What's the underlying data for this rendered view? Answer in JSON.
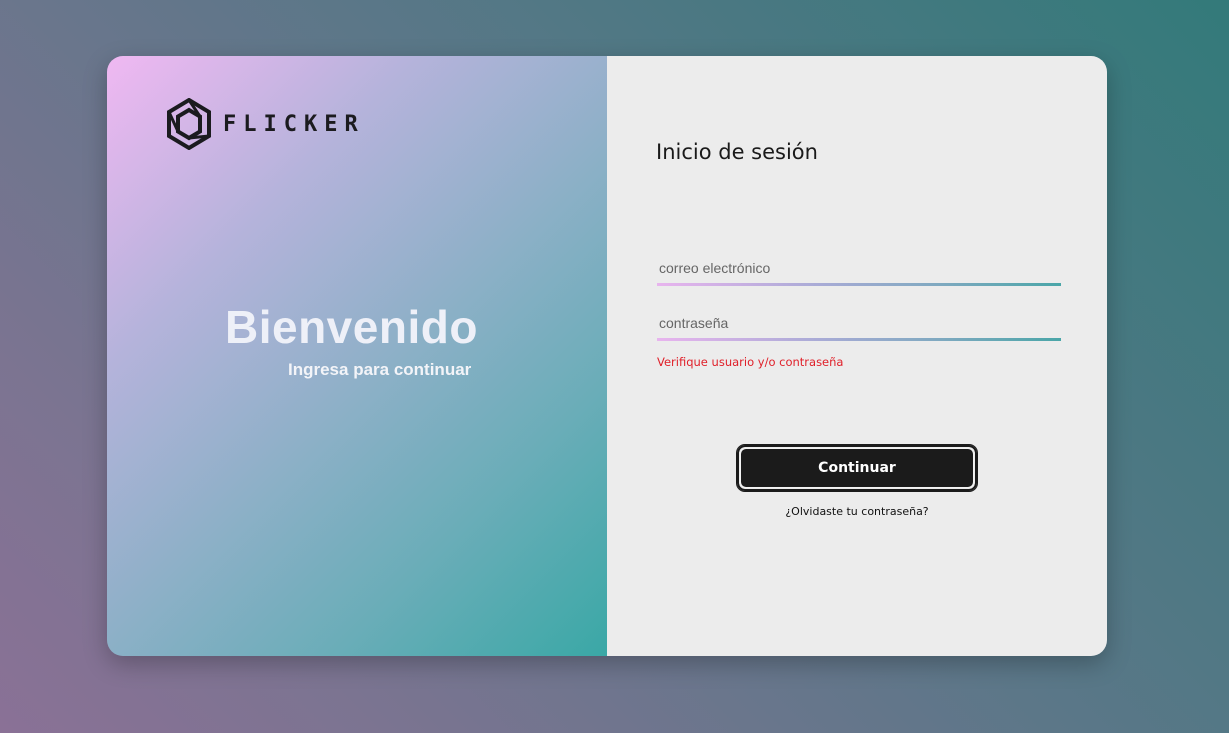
{
  "brand": {
    "name": "FLICKER",
    "logo_icon": "hexagon-swirl-icon"
  },
  "welcome": {
    "title": "Bienvenido",
    "subtitle": "Ingresa para continuar"
  },
  "login": {
    "title": "Inicio de sesión",
    "email": {
      "value": "",
      "placeholder": "correo electrónico"
    },
    "password": {
      "value": "",
      "placeholder": "contraseña"
    },
    "error": "Verifique usuario y/o contraseña",
    "submit_label": "Continuar",
    "forgot_label": "¿Olvidaste tu contraseña?"
  },
  "colors": {
    "accent_start": "#f0b8f2",
    "accent_end": "#3aa8a6",
    "button": "#1b1b1b",
    "error": "#e0202a",
    "panel": "#ececec"
  }
}
